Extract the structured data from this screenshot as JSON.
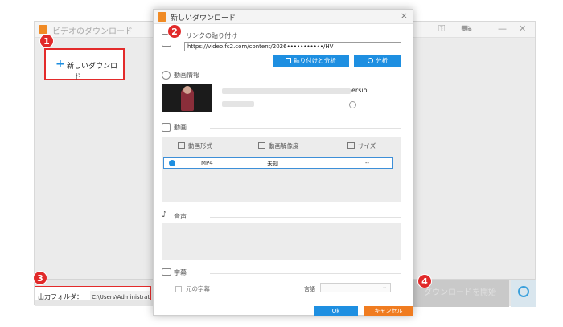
{
  "main_window": {
    "title": "ビデオのダウンロード",
    "new_download_label": "新しいダウンロード",
    "output_folder_label": "出力フォルダ：",
    "output_folder_path": "C:\\Users\\Administrator\\Vide",
    "start_button_label": "ダウンロードを開始"
  },
  "dialog": {
    "title": "新しいダウンロード",
    "close_glyph": "×",
    "paste_link_label": "リンクの貼り付け",
    "url_value": "https://video.fc2.com/content/2026•••••••••••/HV",
    "paste_analyze_button": "貼り付けと分析",
    "analyze_button": "分析",
    "video_info_label": "動画情報",
    "info_text": "ersio...",
    "video_section_label": "動画",
    "table_headers": [
      "動画形式",
      "動画解像度",
      "サイズ"
    ],
    "table_rows": [
      {
        "format": "MP4",
        "resolution": "未知",
        "size": "--"
      }
    ],
    "audio_section_label": "音声",
    "subtitle_section_label": "字幕",
    "subtitle_original_label": "元の字幕",
    "subtitle_language_label": "言語",
    "ok_button": "Ok",
    "cancel_button": "キャンセル"
  },
  "steps": [
    "1",
    "2",
    "3",
    "4"
  ],
  "colors": {
    "badge_red": "#e12a2a",
    "accent_blue": "#1e8fe1",
    "cancel_orange": "#f07c20",
    "app_orange": "#f08a24"
  },
  "icons": [
    "app-icon",
    "plus-icon",
    "close-icon",
    "link-icon",
    "paste-icon",
    "search-icon",
    "info-icon",
    "video-icon",
    "format-icon",
    "resolution-icon",
    "size-icon",
    "check-icon",
    "music-icon",
    "subtitle-icon",
    "alarm-icon",
    "key-icon",
    "cart-icon"
  ]
}
